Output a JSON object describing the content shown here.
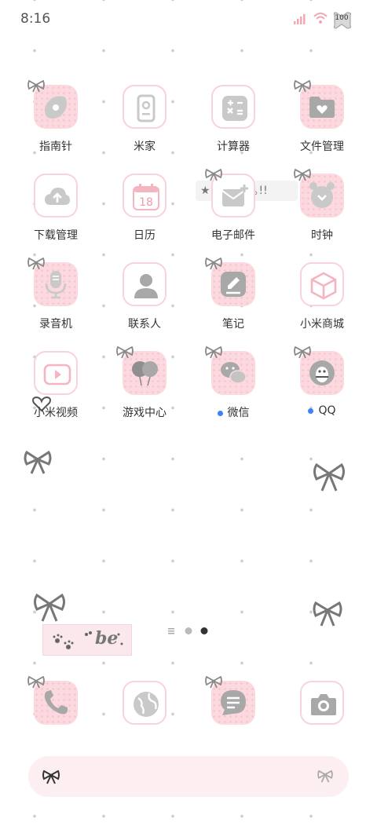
{
  "status_bar": {
    "time": "8:16",
    "battery": "100"
  },
  "apps": [
    {
      "id": "compass",
      "label": "指南针",
      "icon": "compass-icon",
      "style": "pink"
    },
    {
      "id": "mi-home",
      "label": "米家",
      "icon": "mi-home-icon",
      "style": "outline"
    },
    {
      "id": "calculator",
      "label": "计算器",
      "icon": "calculator-icon",
      "style": "outline"
    },
    {
      "id": "file-manager",
      "label": "文件管理",
      "icon": "folder-icon",
      "style": "pink"
    },
    {
      "id": "downloads",
      "label": "下载管理",
      "icon": "cloud-upload-icon",
      "style": "outline"
    },
    {
      "id": "calendar",
      "label": "日历",
      "icon": "calendar-icon",
      "style": "outline",
      "day": "18"
    },
    {
      "id": "email",
      "label": "电子邮件",
      "icon": "mail-icon",
      "style": "outline"
    },
    {
      "id": "clock",
      "label": "时钟",
      "icon": "alarm-clock-icon",
      "style": "pink"
    },
    {
      "id": "recorder",
      "label": "录音机",
      "icon": "microphone-icon",
      "style": "pink"
    },
    {
      "id": "contacts",
      "label": "联系人",
      "icon": "person-icon",
      "style": "outline"
    },
    {
      "id": "notes",
      "label": "笔记",
      "icon": "pencil-note-icon",
      "style": "pink"
    },
    {
      "id": "mi-store",
      "label": "小米商城",
      "icon": "cube-icon",
      "style": "outline"
    },
    {
      "id": "mi-video",
      "label": "小米视频",
      "icon": "video-play-icon",
      "style": "outline"
    },
    {
      "id": "game-center",
      "label": "游戏中心",
      "icon": "balloon-icon",
      "style": "pink"
    },
    {
      "id": "wechat",
      "label": "微信",
      "icon": "wechat-icon",
      "style": "pink",
      "badge": true
    },
    {
      "id": "qq",
      "label": "QQ",
      "icon": "qq-penguin-icon",
      "style": "pink",
      "badge": true
    }
  ],
  "dock": [
    {
      "id": "phone",
      "icon": "phone-icon",
      "style": "pink"
    },
    {
      "id": "browser",
      "icon": "globe-icon",
      "style": "outline"
    },
    {
      "id": "messages",
      "icon": "message-icon",
      "style": "pink"
    },
    {
      "id": "camera",
      "icon": "camera-icon",
      "style": "outline"
    }
  ],
  "widgets": {
    "sticker_text": "★ ... 일상˚｡!!",
    "sticker_box_text": "be"
  },
  "colors": {
    "pink": "#fbd9df",
    "pink_border": "#f7d3da",
    "icon_grey": "#c9c9c9",
    "badge_blue": "#3b82f6"
  }
}
